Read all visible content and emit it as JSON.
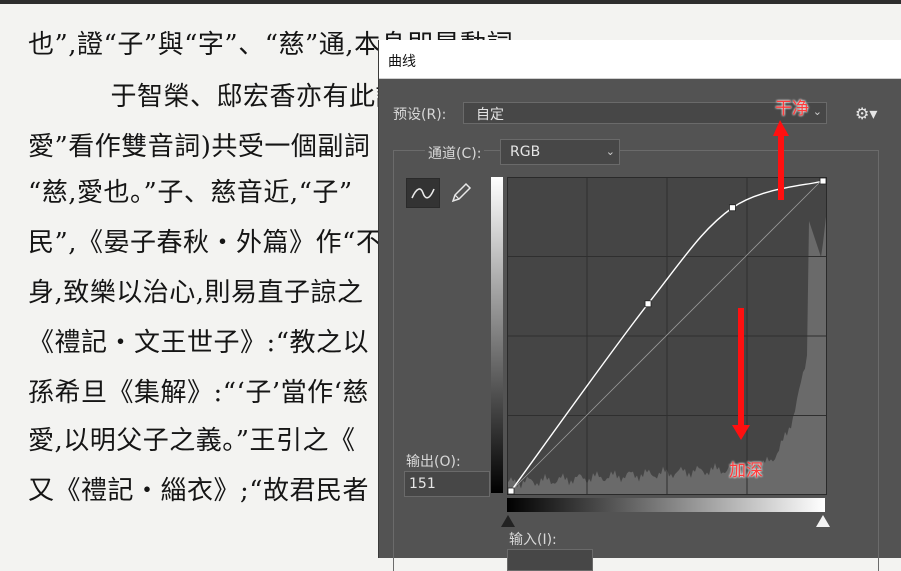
{
  "background_page": {
    "lines": [
      "也”,證“子”與“字”、“慈”通,本身即是動詞",
      "　于智榮、邸宏香亦有此說",
      "愛”看作雙音詞)共受一個副詞",
      "“慈,愛也。”子、慈音近,“子”",
      "民”,《晏子春秋・外篇》作“不",
      "身,致樂以治心,則易直子諒之",
      "《禮記・文王世子》:“教之以",
      "孫希旦《集解》:“‘子’當作‘慈",
      "愛,以明父子之義。”王引之《",
      "又《禮記・緇衣》;“故君民者"
    ]
  },
  "dialog": {
    "title": "曲线",
    "preset_label": "预设(R):",
    "preset_value": "自定",
    "channel_label": "通道(C):",
    "channel_value": "RGB",
    "output_label": "输出(O):",
    "output_value": "151",
    "input_label": "输入(I):",
    "icons": [
      "curve-tool-icon",
      "pencil-tool-icon",
      "gear-icon",
      "chevron-down-icon"
    ]
  },
  "annotations": {
    "top": "干净",
    "bottom": "加深",
    "color": "#ff1a1a"
  },
  "curve": {
    "points": [
      [
        0,
        0
      ],
      [
        112,
        154
      ],
      [
        181,
        233
      ],
      [
        255,
        255
      ]
    ],
    "input_range": [
      0,
      255
    ],
    "output_range": [
      0,
      255
    ]
  }
}
